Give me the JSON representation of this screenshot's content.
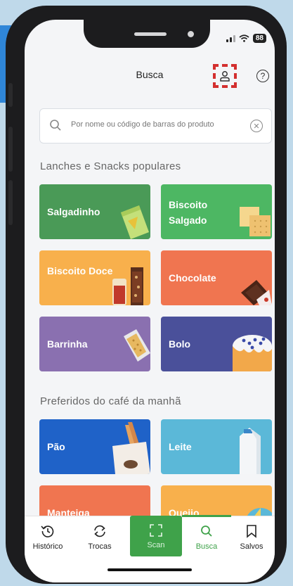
{
  "status": {
    "battery": "88"
  },
  "header": {
    "title": "Busca"
  },
  "search": {
    "placeholder": "Por nome ou código de barras do produto"
  },
  "sections": [
    {
      "title": "Lanches e Snacks populares"
    },
    {
      "title": "Preferidos do café da manhã"
    }
  ],
  "snacks": [
    {
      "label": "Salgadinho",
      "color": "#4a9a57"
    },
    {
      "label": "Biscoito Salgado",
      "color": "#4db763"
    },
    {
      "label": "Biscoito Doce",
      "color": "#f8b04c"
    },
    {
      "label": "Chocolate",
      "color": "#f07550"
    },
    {
      "label": "Barrinha",
      "color": "#8a70b0"
    },
    {
      "label": "Bolo",
      "color": "#4a509a"
    }
  ],
  "breakfast": [
    {
      "label": "Pão",
      "color": "#1f62c8"
    },
    {
      "label": "Leite",
      "color": "#5bb8d8"
    },
    {
      "label": "Manteiga",
      "color": "#f07550"
    },
    {
      "label": "Queijo",
      "color": "#f8b04c"
    }
  ],
  "tabs": [
    {
      "label": "Histórico",
      "icon": "history-icon"
    },
    {
      "label": "Trocas",
      "icon": "swap-icon"
    },
    {
      "label": "Scan",
      "icon": "scan-icon"
    },
    {
      "label": "Busca",
      "icon": "search-icon"
    },
    {
      "label": "Salvos",
      "icon": "bookmark-icon"
    }
  ],
  "colors": {
    "accent": "#3fa24a",
    "highlight": "#d32f2f"
  }
}
